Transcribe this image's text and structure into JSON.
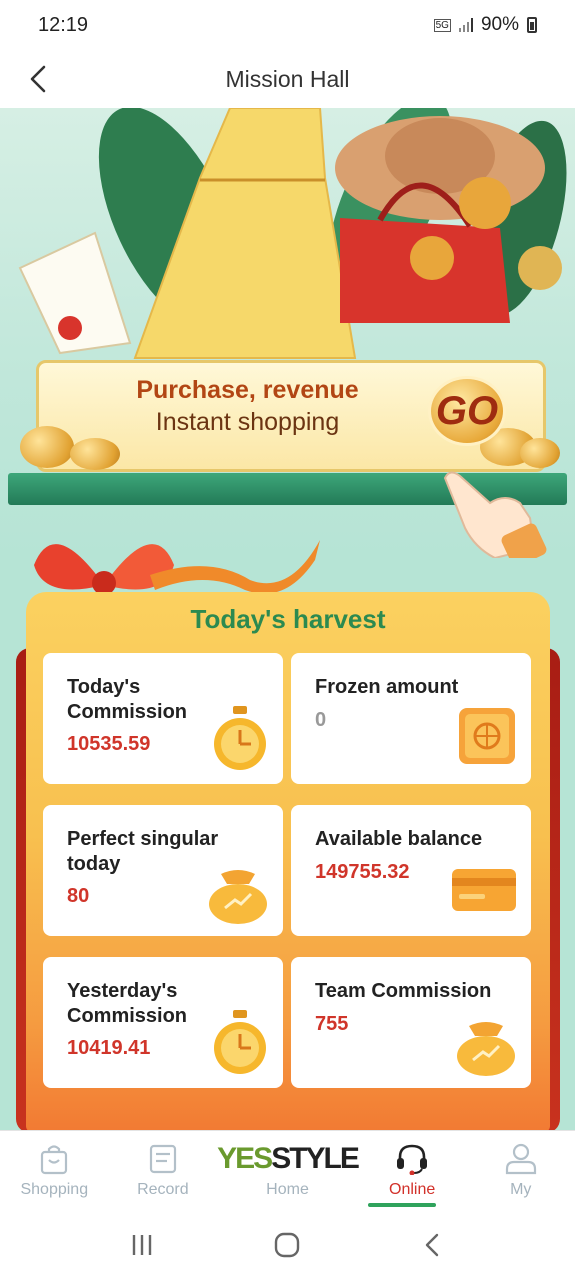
{
  "status_bar": {
    "time": "12:19",
    "network": "5G",
    "battery": "90%"
  },
  "header": {
    "title": "Mission Hall"
  },
  "banner": {
    "line1": "Purchase, revenue",
    "line2": "Instant shopping",
    "go_label": "GO"
  },
  "harvest": {
    "title": "Today's harvest",
    "cards": [
      {
        "label": "Today's Commission",
        "value": "10535.59"
      },
      {
        "label": "Frozen amount",
        "value": "0"
      },
      {
        "label": "Perfect singular today",
        "value": "80"
      },
      {
        "label": "Available balance",
        "value": "149755.32"
      },
      {
        "label": "Yesterday's Commission",
        "value": "10419.41"
      },
      {
        "label": "Team Commission",
        "value": "755"
      }
    ]
  },
  "nav": {
    "items": [
      {
        "label": "Shopping",
        "icon": "shopping-bag-icon"
      },
      {
        "label": "Record",
        "icon": "record-icon"
      },
      {
        "label": "Home",
        "icon": "yesstyle-logo"
      },
      {
        "label": "Online",
        "icon": "headset-icon",
        "active": true
      },
      {
        "label": "My",
        "icon": "user-icon"
      }
    ],
    "logo_part1": "YES",
    "logo_part2": "STYLE"
  },
  "colors": {
    "accent": "#2c8a50",
    "value_red": "#d0352a",
    "active_nav": "#d2312a"
  }
}
